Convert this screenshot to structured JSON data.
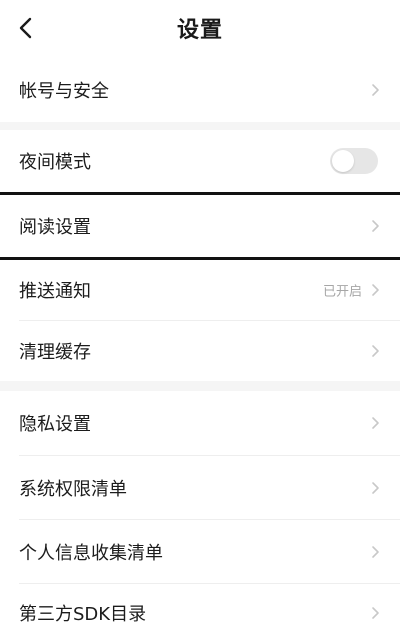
{
  "header": {
    "title": "设置",
    "back_icon": "back-chevron-icon"
  },
  "sections": [
    {
      "items": [
        {
          "label": "帐号与安全"
        }
      ]
    },
    {
      "night_mode": {
        "label": "夜间模式",
        "toggle_on": false
      },
      "reading": {
        "label": "阅读设置"
      },
      "push": {
        "label": "推送通知",
        "value": "已开启"
      },
      "cache": {
        "label": "清理缓存"
      }
    },
    {
      "items": [
        {
          "label": "隐私设置"
        },
        {
          "label": "系统权限清单"
        },
        {
          "label": "个人信息收集清单"
        },
        {
          "label": "第三方SDK目录"
        }
      ]
    }
  ],
  "colors": {
    "background": "#ffffff",
    "group_gap": "#f5f5f5",
    "secondary_text": "#a6a6a6",
    "chevron": "#c8c8c8"
  }
}
